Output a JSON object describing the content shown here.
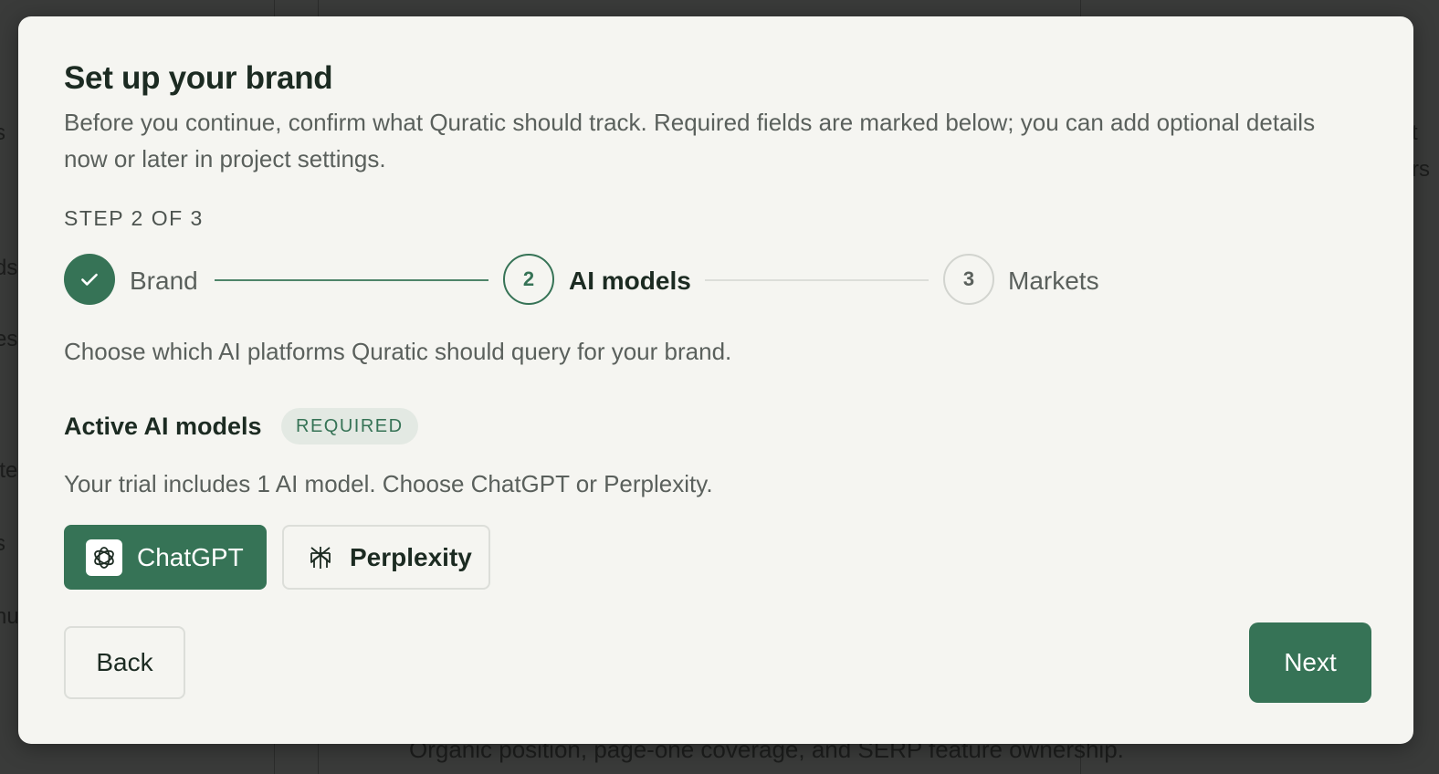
{
  "background": {
    "left_fragments": [
      "s",
      "ds",
      "es",
      "ite",
      "s",
      "nu"
    ],
    "right_fragments": [
      "t",
      "rs"
    ],
    "bottom_text": "Organic position, page-one coverage, and SERP feature ownership."
  },
  "modal": {
    "title": "Set up your brand",
    "subtitle": "Before you continue, confirm what Quratic should track. Required fields are marked below; you can add optional details now or later in project settings.",
    "step_label": "STEP 2 OF 3",
    "steps": [
      {
        "number": "1",
        "label": "Brand",
        "state": "done",
        "icon": "check-icon"
      },
      {
        "number": "2",
        "label": "AI models",
        "state": "active"
      },
      {
        "number": "3",
        "label": "Markets",
        "state": "todo"
      }
    ],
    "intro": "Choose which AI platforms Quratic should query for your brand.",
    "section_title": "Active AI models",
    "required_badge": "REQUIRED",
    "hint": "Your trial includes 1 AI model. Choose ChatGPT or Perplexity.",
    "models": [
      {
        "label": "ChatGPT",
        "icon": "chatgpt-logo-icon",
        "selected": true
      },
      {
        "label": "Perplexity",
        "icon": "perplexity-logo-icon",
        "selected": false
      }
    ],
    "back_label": "Back",
    "next_label": "Next"
  },
  "colors": {
    "accent": "#367356",
    "modal_bg": "#f5f5f1",
    "text_primary": "#1c2b22",
    "text_secondary": "#5a605c",
    "badge_bg": "#e3e9e3"
  }
}
